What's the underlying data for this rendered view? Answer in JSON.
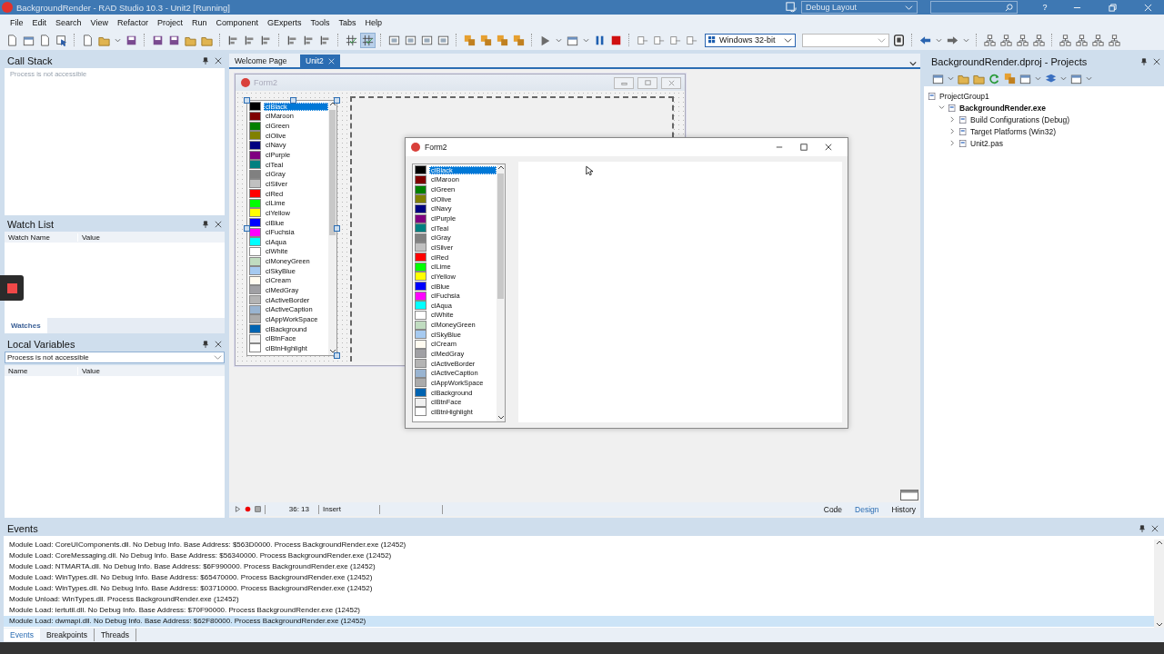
{
  "window": {
    "title": "BackgroundRender - RAD Studio 10.3 - Unit2 [Running]",
    "layout": "Debug Layout",
    "help": "?"
  },
  "menu": [
    "File",
    "Edit",
    "Search",
    "View",
    "Refactor",
    "Project",
    "Run",
    "Component",
    "GExperts",
    "Tools",
    "Tabs",
    "Help"
  ],
  "toolbar": {
    "platform": "Windows 32-bit",
    "snap_to_grid": true
  },
  "call_stack": {
    "title": "Call Stack",
    "message": "Process is not accessible"
  },
  "watch_list": {
    "title": "Watch List",
    "columns": [
      "Watch Name",
      "Value"
    ],
    "tabs": [
      {
        "label": "Watches",
        "selected": true
      }
    ]
  },
  "local_variables": {
    "title": "Local Variables",
    "scope": "Process is not accessible",
    "columns": [
      "Name",
      "Value"
    ]
  },
  "editor": {
    "tabs": [
      {
        "label": "Welcome Page",
        "selected": false
      },
      {
        "label": "Unit2",
        "selected": true
      }
    ],
    "design_form": {
      "title": "Form2",
      "items": [
        {
          "label": "clBlack",
          "color": "#000000",
          "selected": true
        },
        {
          "label": "clMaroon",
          "color": "#800000",
          "selected": false
        },
        {
          "label": "clGreen",
          "color": "#008000",
          "selected": false
        },
        {
          "label": "clOlive",
          "color": "#808000",
          "selected": false
        },
        {
          "label": "clNavy",
          "color": "#000080",
          "selected": false
        },
        {
          "label": "clPurple",
          "color": "#800080",
          "selected": false
        },
        {
          "label": "clTeal",
          "color": "#008080",
          "selected": false
        },
        {
          "label": "clGray",
          "color": "#808080",
          "selected": false
        },
        {
          "label": "clSilver",
          "color": "#c0c0c0",
          "selected": false
        },
        {
          "label": "clRed",
          "color": "#ff0000",
          "selected": false
        },
        {
          "label": "clLime",
          "color": "#00ff00",
          "selected": false
        },
        {
          "label": "clYellow",
          "color": "#ffff00",
          "selected": false
        },
        {
          "label": "clBlue",
          "color": "#0000ff",
          "selected": false
        },
        {
          "label": "clFuchsia",
          "color": "#ff00ff",
          "selected": false
        },
        {
          "label": "clAqua",
          "color": "#00ffff",
          "selected": false
        },
        {
          "label": "clWhite",
          "color": "#ffffff",
          "selected": false
        },
        {
          "label": "clMoneyGreen",
          "color": "#c0dcc0",
          "selected": false
        },
        {
          "label": "clSkyBlue",
          "color": "#a6caf0",
          "selected": false
        },
        {
          "label": "clCream",
          "color": "#fffbf0",
          "selected": false
        },
        {
          "label": "clMedGray",
          "color": "#a0a0a4",
          "selected": false
        },
        {
          "label": "clActiveBorder",
          "color": "#b4b4b4",
          "selected": false
        },
        {
          "label": "clActiveCaption",
          "color": "#99b4d1",
          "selected": false
        },
        {
          "label": "clAppWorkSpace",
          "color": "#ababab",
          "selected": false
        },
        {
          "label": "clBackground",
          "color": "#0063b1",
          "selected": false
        },
        {
          "label": "clBtnFace",
          "color": "#f0f0f0",
          "selected": false
        },
        {
          "label": "clBtnHighlight",
          "color": "#ffffff",
          "selected": false
        }
      ]
    },
    "running_form": {
      "title": "Form2",
      "items": [
        {
          "label": "clBlack",
          "color": "#000000",
          "selected": true
        },
        {
          "label": "clMaroon",
          "color": "#800000",
          "selected": false
        },
        {
          "label": "clGreen",
          "color": "#008000",
          "selected": false
        },
        {
          "label": "clOlive",
          "color": "#808000",
          "selected": false
        },
        {
          "label": "clNavy",
          "color": "#000080",
          "selected": false
        },
        {
          "label": "clPurple",
          "color": "#800080",
          "selected": false
        },
        {
          "label": "clTeal",
          "color": "#008080",
          "selected": false
        },
        {
          "label": "clGray",
          "color": "#808080",
          "selected": false
        },
        {
          "label": "clSilver",
          "color": "#c0c0c0",
          "selected": false
        },
        {
          "label": "clRed",
          "color": "#ff0000",
          "selected": false
        },
        {
          "label": "clLime",
          "color": "#00ff00",
          "selected": false
        },
        {
          "label": "clYellow",
          "color": "#ffff00",
          "selected": false
        },
        {
          "label": "clBlue",
          "color": "#0000ff",
          "selected": false
        },
        {
          "label": "clFuchsia",
          "color": "#ff00ff",
          "selected": false
        },
        {
          "label": "clAqua",
          "color": "#00ffff",
          "selected": false
        },
        {
          "label": "clWhite",
          "color": "#ffffff",
          "selected": false
        },
        {
          "label": "clMoneyGreen",
          "color": "#c0dcc0",
          "selected": false
        },
        {
          "label": "clSkyBlue",
          "color": "#a6caf0",
          "selected": false
        },
        {
          "label": "clCream",
          "color": "#fffbf0",
          "selected": false
        },
        {
          "label": "clMedGray",
          "color": "#a0a0a4",
          "selected": false
        },
        {
          "label": "clActiveBorder",
          "color": "#b4b4b4",
          "selected": false
        },
        {
          "label": "clActiveCaption",
          "color": "#99b4d1",
          "selected": false
        },
        {
          "label": "clAppWorkSpace",
          "color": "#ababab",
          "selected": false
        },
        {
          "label": "clBackground",
          "color": "#0063b1",
          "selected": false
        },
        {
          "label": "clBtnFace",
          "color": "#f0f0f0",
          "selected": false
        },
        {
          "label": "clBtnHighlight",
          "color": "#ffffff",
          "selected": false
        }
      ]
    },
    "status": {
      "position": "36: 13",
      "mode": "Insert"
    },
    "view_tabs": [
      {
        "label": "Code",
        "selected": false
      },
      {
        "label": "Design",
        "selected": true
      },
      {
        "label": "History",
        "selected": false
      }
    ]
  },
  "projects": {
    "title": "BackgroundRender.dproj - Projects",
    "tree": [
      {
        "label": "ProjectGroup1",
        "active": false,
        "children": [
          {
            "label": "BackgroundRender.exe",
            "active": true,
            "expanded": true,
            "children": [
              {
                "label": "Build Configurations (Debug)",
                "active": false,
                "expanded": false
              },
              {
                "label": "Target Platforms (Win32)",
                "active": false,
                "expanded": false
              },
              {
                "label": "Unit2.pas",
                "active": false,
                "expanded": false
              }
            ]
          }
        ]
      }
    ]
  },
  "events": {
    "title": "Events",
    "lines": [
      {
        "text": "Module Load: CoreUIComponents.dll. No Debug Info. Base Address: $563D0000. Process BackgroundRender.exe (12452)",
        "selected": false
      },
      {
        "text": "Module Load: CoreMessaging.dll. No Debug Info. Base Address: $56340000. Process BackgroundRender.exe (12452)",
        "selected": false
      },
      {
        "text": "Module Load: NTMARTA.dll. No Debug Info. Base Address: $6F990000. Process BackgroundRender.exe (12452)",
        "selected": false
      },
      {
        "text": "Module Load: WinTypes.dll. No Debug Info. Base Address: $65470000. Process BackgroundRender.exe (12452)",
        "selected": false
      },
      {
        "text": "Module Load: WinTypes.dll. No Debug Info. Base Address: $03710000. Process BackgroundRender.exe (12452)",
        "selected": false
      },
      {
        "text": "Module Unload: WinTypes.dll. Process BackgroundRender.exe (12452)",
        "selected": false
      },
      {
        "text": "Module Load: iertutil.dll. No Debug Info. Base Address: $70F90000. Process BackgroundRender.exe (12452)",
        "selected": false
      },
      {
        "text": "Module Load: dwmapi.dll. No Debug Info. Base Address: $62F80000. Process BackgroundRender.exe (12452)",
        "selected": true
      }
    ],
    "tabs": [
      {
        "label": "Events",
        "selected": true
      },
      {
        "label": "Breakpoints",
        "selected": false
      },
      {
        "label": "Threads",
        "selected": false
      }
    ]
  }
}
